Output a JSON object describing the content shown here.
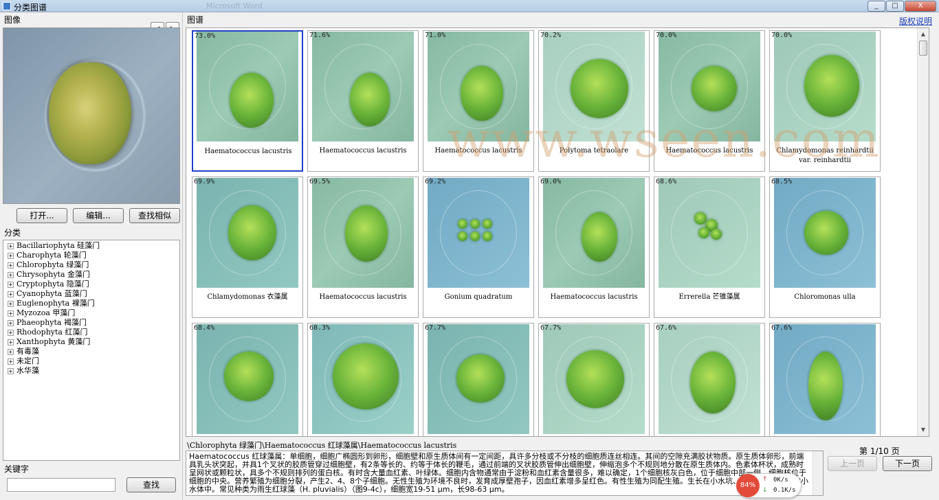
{
  "window": {
    "title": "分类图谱",
    "background_title": "Microsoft Word",
    "min": "_",
    "max": "□",
    "close": "X"
  },
  "left": {
    "image_label": "图像",
    "prev": "<",
    "next": ">",
    "buttons": {
      "open": "打开...",
      "edit": "编辑...",
      "find_similar": "查找相似"
    },
    "class_label": "分类",
    "tree": [
      "Bacillariophyta 硅藻门",
      "Charophyta 轮藻门",
      "Chlorophyta 绿藻门",
      "Chrysophyta 金藻门",
      "Cryptophyta 隐藻门",
      "Cyanophyta 蓝藻门",
      "Euglenophyta 裸藻门",
      "Myzozoa 甲藻门",
      "Phaeophyta 褐藻门",
      "Rhodophyta 红藻门",
      "Xanthophyta 黄藻门",
      "有毒藻",
      "未定门",
      "水华藻"
    ],
    "keyword_label": "关键字",
    "keyword_value": "",
    "search_button": "查找"
  },
  "right": {
    "label": "图谱",
    "copyright_link": "版权说明",
    "watermark": "www.wseen.com",
    "cards": [
      {
        "pct": "73.0%",
        "caption": "Haematococcus lacustris"
      },
      {
        "pct": "71.6%",
        "caption": "Haematococcus lacustris"
      },
      {
        "pct": "71.0%",
        "caption": "Haematococcus lacustris"
      },
      {
        "pct": "70.2%",
        "caption": "Polytoma tetraolare"
      },
      {
        "pct": "70.0%",
        "caption": "Haematococcus lacustris"
      },
      {
        "pct": "70.0%",
        "caption": "Chlamydomonas reinhardtii var. reinhardtii"
      },
      {
        "pct": "69.9%",
        "caption": "Chlamydomonas 衣藻属"
      },
      {
        "pct": "69.5%",
        "caption": "Haematococcus lacustris"
      },
      {
        "pct": "69.2%",
        "caption": "Gonium quadratum"
      },
      {
        "pct": "69.0%",
        "caption": "Haematococcus lacustris"
      },
      {
        "pct": "68.6%",
        "caption": "Errerella 芒锥藻属"
      },
      {
        "pct": "68.5%",
        "caption": "Chloromonas ulla"
      },
      {
        "pct": "68.4%",
        "caption": ""
      },
      {
        "pct": "68.3%",
        "caption": ""
      },
      {
        "pct": "67.7%",
        "caption": ""
      },
      {
        "pct": "67.7%",
        "caption": ""
      },
      {
        "pct": "67.6%",
        "caption": ""
      },
      {
        "pct": "67.6%",
        "caption": ""
      }
    ],
    "path": "\\Chlorophyta 绿藻门\\Haematococcus 红球藻属\\Haematococcus lacustris",
    "description": "Haematococcus 红球藻属：单细胞，细胞广椭圆形到卵形，细胞壁和原生质体间有一定间距，具许多分枝或不分枝的细胞质连丝相连。其间的空隙充满胶状物质。原生质体卵形，前端具乳头状突起，并具1个叉状的胶质管穿过细胞壁，有2条等长的、约等于体长的鞭毛，通过前端的叉状胶质管伸出细胞壁，伸缩泡多个不规则地分散在原生质体内。色素体杯状，成熟时呈网状或颗粒状，具多个不规则排列的蛋白核。有时含大量血红素、叶绿体。细胞内含物通常由于淀粉和血红素含量很多，难以确定，1个细胞核灰白色，位于细胞中部一侧。细胞核位于细胞的中央。营养繁殖为细胞分裂，产生2、4、8个子细胞。无性生殖为环境不良时，发育成厚壁孢子，因血红素增多呈红色。有性生殖为同配生殖。生长在小水坑、小水沟或沼泽化的小水体中。常见种类为雨生红球藻（H. pluvialis）（图9-4c），细胞宽19-51 μm，长98-63 μm。",
    "page_info": "第 1/10 页",
    "prev_page": "上一页",
    "next_page": "下一页"
  },
  "speed_widget": {
    "percent": "84%",
    "up": "0K/s",
    "down": "0.1K/s"
  }
}
